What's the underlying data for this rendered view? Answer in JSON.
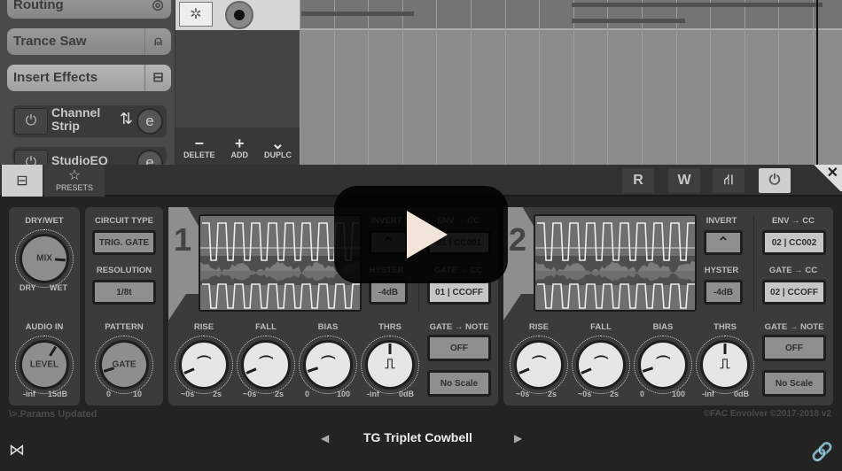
{
  "host": {
    "sidebar": {
      "items": [
        {
          "label": "Routing",
          "icon": "midi-din-icon"
        },
        {
          "label": "Trance Saw",
          "icon": "piano-icon"
        },
        {
          "label": "Insert Effects",
          "icon": "insert-fx-icon"
        }
      ],
      "effects": [
        {
          "name": "Channel Strip",
          "power_icon": "power-icon",
          "reorder_icon": "swap-icon",
          "edit_icon": "edit-icon"
        },
        {
          "name": "StudioEQ",
          "power_icon": "power-icon",
          "edit_icon": "edit-icon"
        }
      ]
    },
    "clip_tools": {
      "delete": "DELETE",
      "add": "ADD",
      "duplicate": "DUPLC",
      "delete_glyph": "−",
      "add_glyph": "+",
      "dup_glyph": "⌄"
    }
  },
  "plugin": {
    "toolbar": {
      "insert_tab_glyph": "⊟",
      "presets_label": "PRESETS",
      "presets_glyph": "☆",
      "read_label": "R",
      "write_label": "W",
      "routing_glyph": "⛙",
      "power_glyph": "⏻",
      "close_glyph": "✕"
    },
    "global": {
      "dry_wet_label": "DRY/WET",
      "mix_label": "MIX",
      "mix_min": "DRY",
      "mix_max": "WET",
      "mix_value": 0.85,
      "audio_in_label": "AUDIO IN",
      "level_label": "LEVEL",
      "level_min": "-inf",
      "level_max": "15dB",
      "level_value": 0.62,
      "circuit_type_label": "CIRCUIT TYPE",
      "circuit_type_value": "TRIG. GATE",
      "resolution_label": "RESOLUTION",
      "resolution_value": "1/8t",
      "pattern_label": "PATTERN",
      "gate_label": "GATE",
      "pattern_min": "0",
      "pattern_max": "10",
      "pattern_value": 0.1
    },
    "lanes": [
      {
        "number": "1",
        "invert_label": "INVERT",
        "hyster_label": "HYSTER",
        "hyster_value": "-4dB",
        "env_cc_label": "ENV → CC",
        "env_cc_value": "01 | CC001",
        "gate_cc_label": "GATE → CC",
        "gate_cc_value": "01 | CCOFF",
        "gate_note_label": "GATE → NOTE",
        "gate_note_value": "OFF",
        "scale_value": "No Scale",
        "knobs": [
          {
            "label": "RISE",
            "min": "~0s",
            "max": "2s",
            "value": 0.08
          },
          {
            "label": "FALL",
            "min": "~0s",
            "max": "2s",
            "value": 0.08
          },
          {
            "label": "BIAS",
            "min": "0",
            "max": "100",
            "value": 0.1
          },
          {
            "label": "THRS",
            "min": "-inf",
            "max": "0dB",
            "value": 0.5
          }
        ]
      },
      {
        "number": "2",
        "invert_label": "INVERT",
        "hyster_label": "HYSTER",
        "hyster_value": "-4dB",
        "env_cc_label": "ENV → CC",
        "env_cc_value": "02 | CC002",
        "gate_cc_label": "GATE → CC",
        "gate_cc_value": "02 | CCOFF",
        "gate_note_label": "GATE → NOTE",
        "gate_note_value": "OFF",
        "scale_value": "No Scale",
        "knobs": [
          {
            "label": "RISE",
            "min": "~0s",
            "max": "2s",
            "value": 0.08
          },
          {
            "label": "FALL",
            "min": "~0s",
            "max": "2s",
            "value": 0.08
          },
          {
            "label": "BIAS",
            "min": "0",
            "max": "100",
            "value": 0.1
          },
          {
            "label": "THRS",
            "min": "-inf",
            "max": "0dB",
            "value": 0.5
          }
        ]
      }
    ],
    "status": "\\>.Params Updated",
    "copyright": "©FAC Envolver ©2017-2018 v2",
    "preset": {
      "prev_glyph": "◀",
      "name": "TG Triplet Cowbell",
      "next_glyph": "▶"
    },
    "bottom_left_glyph": "⋈",
    "link_glyph": "🔗"
  },
  "overlay": {
    "play_icon": "play-icon"
  }
}
